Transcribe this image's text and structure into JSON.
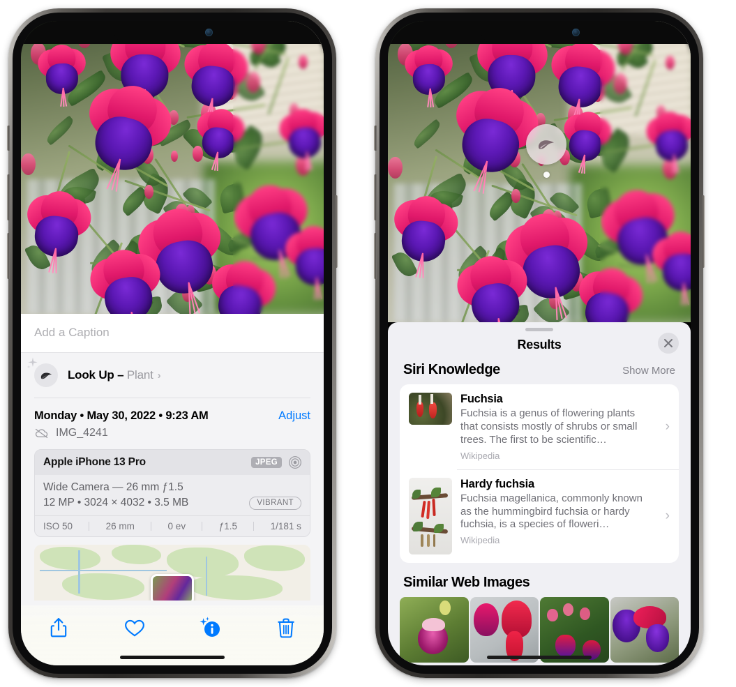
{
  "left_phone": {
    "name": "iPhone showing Photos app detail view",
    "caption": {
      "placeholder": "Add a Caption",
      "value": ""
    },
    "lookup": {
      "label": "Look Up",
      "dash": "–",
      "subject": "Plant",
      "chevron": "›",
      "icon": "leaf-icon",
      "sparkle": "sparkle-icon"
    },
    "info": {
      "date_line": "Monday • May 30, 2022 • 9:23 AM",
      "adjust_label": "Adjust",
      "file_name": "IMG_4241",
      "cloud_icon": "cloud-slash-icon"
    },
    "camera_card": {
      "model": "Apple iPhone 13 Pro",
      "format_badge": "JPEG",
      "raw_icon": "aperture-icon",
      "lens_line": "Wide Camera — 26 mm ƒ1.5",
      "size_line": "12 MP • 3024 × 4032 • 3.5 MB",
      "style_badge": "VIBRANT",
      "exif": [
        "ISO 50",
        "26 mm",
        "0 ev",
        "ƒ1.5",
        "1/181 s"
      ]
    },
    "toolbar": [
      {
        "name": "share-button",
        "icon": "share-icon"
      },
      {
        "name": "favorite-button",
        "icon": "heart-icon"
      },
      {
        "name": "info-button",
        "icon": "info-sparkle-icon",
        "active": true
      },
      {
        "name": "delete-button",
        "icon": "trash-icon"
      }
    ],
    "accent_color": "#007aff"
  },
  "right_phone": {
    "name": "iPhone showing Visual Look Up results",
    "photo_badge": {
      "icon": "leaf-icon",
      "label": "Visual Look Up indicator"
    },
    "sheet": {
      "title": "Results",
      "close_icon": "close-icon",
      "grabber": "drag-handle"
    },
    "siri_knowledge": {
      "title": "Siri Knowledge",
      "show_more": "Show More",
      "items": [
        {
          "title": "Fuchsia",
          "description": "Fuchsia is a genus of flowering plants that consists mostly of shrubs or small trees. The first to be scientific…",
          "source": "Wikipedia",
          "chevron": "›",
          "thumb": "fuchsia-red-flowers-thumbnail"
        },
        {
          "title": "Hardy fuchsia",
          "description": "Fuchsia magellanica, commonly known as the hummingbird fuchsia or hardy fuchsia, is a species of floweri…",
          "source": "Wikipedia",
          "chevron": "›",
          "thumb": "hardy-fuchsia-specimen-thumbnail"
        }
      ]
    },
    "similar_web_images": {
      "title": "Similar Web Images",
      "items": [
        "fuchsia-pink-white-bloom",
        "fuchsia-red-closeup",
        "fuchsia-bush-buds",
        "fuchsia-purple-magenta"
      ]
    }
  }
}
